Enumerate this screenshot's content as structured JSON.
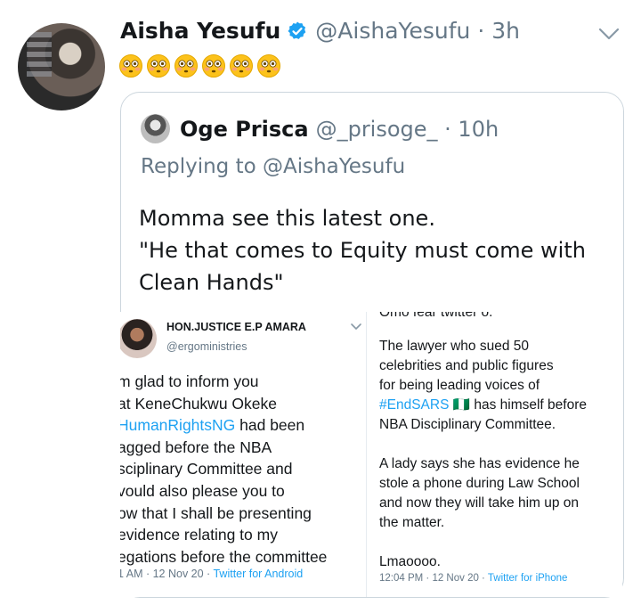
{
  "tweet": {
    "author_name": "Aisha Yesufu",
    "author_handle": "@AishaYesufu · 3h",
    "emoji_count": 6,
    "emoji_text": "😳😳😳😳😳😳"
  },
  "quoted": {
    "author_name": "Oge Prisca",
    "author_handle": "@_prisoge_ · 10h",
    "replying_label": "Replying to",
    "replying_to": "@AishaYesufu",
    "body": "Momma see this latest one.\n\"He that comes to Equity must come with Clean Hands\""
  },
  "screenshot_left": {
    "name": "HON.JUSTICE E.P AMARA",
    "handle": "@ergoministries",
    "lines": [
      "m glad to inform you",
      "at KeneChukwu Okeke",
      "HumanRightsNG had been",
      "agged before the NBA",
      "sciplinary Committee and",
      "vould also please you to",
      "ow that I shall be presenting",
      " evidence relating to my",
      "egations before the committee"
    ],
    "hashtag_line_index": 2,
    "meta_time": "1 AM · 12 Nov 20 · ",
    "meta_source": "Twitter for Android"
  },
  "screenshot_right": {
    "cut_text": "Omo fear twitter o.",
    "lines_a": [
      "The lawyer who sued 50",
      "celebrities and public figures",
      "for being leading voices of"
    ],
    "hashtag": "#EndSARS",
    "hashtag_rest": " 🇳🇬 has himself before",
    "lines_b": [
      "NBA Disciplinary Committee."
    ],
    "lines_c": [
      "A lady says she has evidence he",
      "stole a phone during Law School",
      "and now they will take him up on",
      "the matter."
    ],
    "lines_d": [
      "Lmaoooo."
    ],
    "meta_time": "12:04 PM · 12 Nov 20 · ",
    "meta_source": "Twitter for iPhone"
  },
  "colors": {
    "text": "#14171a",
    "secondary": "#657786",
    "accent": "#1da1f2",
    "border": "#ccd6dd"
  },
  "icons": [
    "verified-badge-icon",
    "chevron-down-icon",
    "flushed-face-emoji"
  ]
}
